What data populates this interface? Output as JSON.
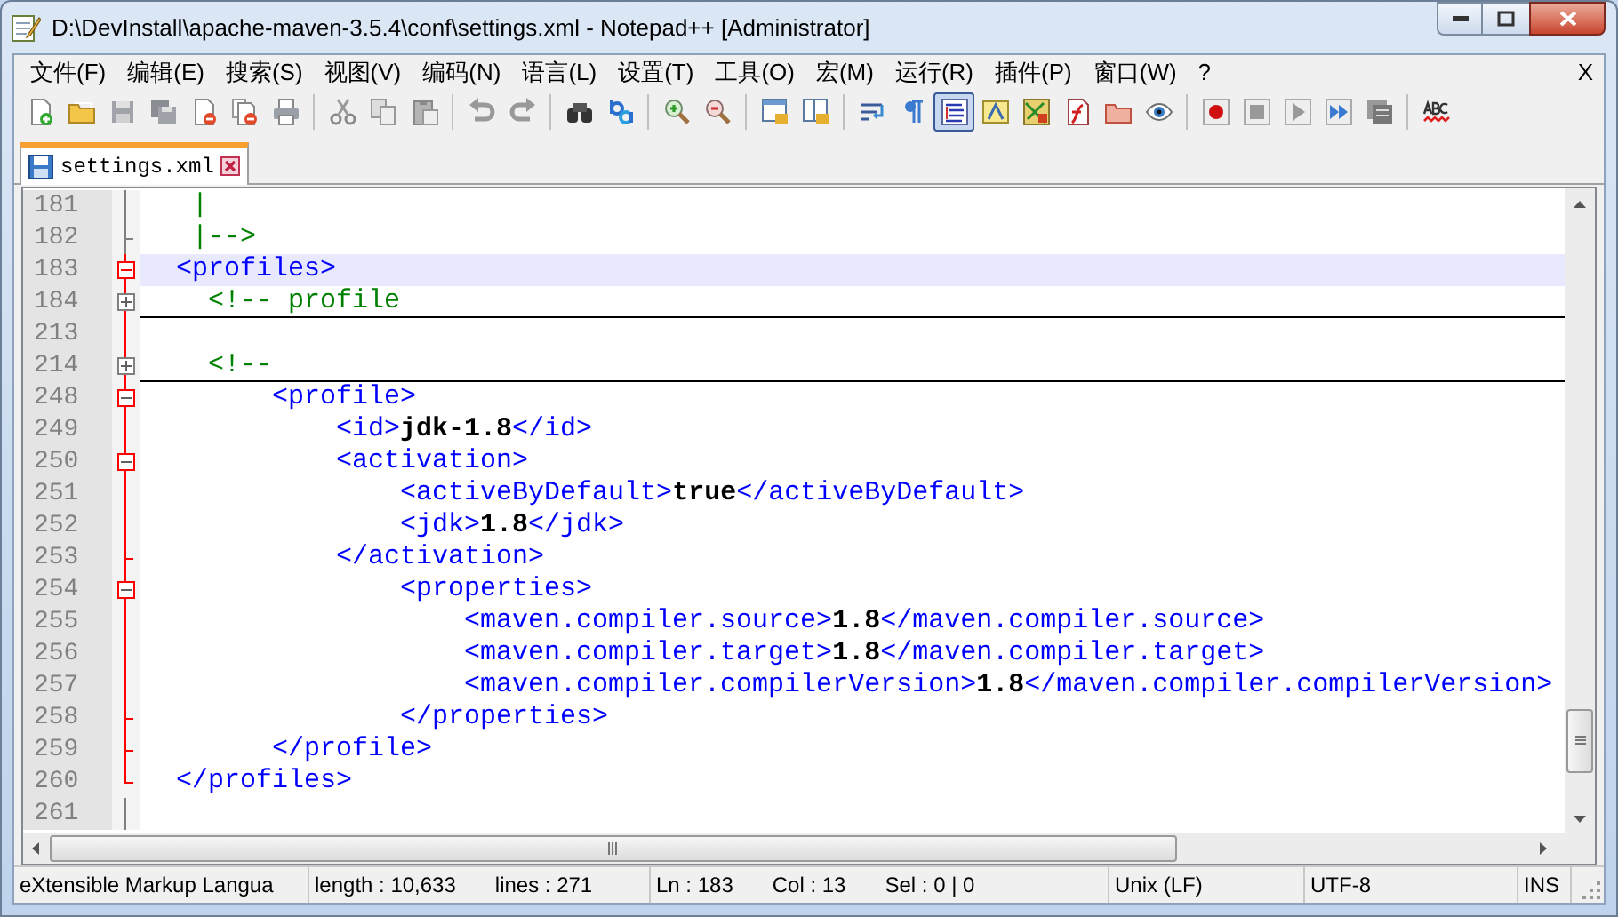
{
  "window": {
    "title": "D:\\DevInstall\\apache-maven-3.5.4\\conf\\settings.xml - Notepad++ [Administrator]"
  },
  "menu": [
    "文件(F)",
    "编辑(E)",
    "搜索(S)",
    "视图(V)",
    "编码(N)",
    "语言(L)",
    "设置(T)",
    "工具(O)",
    "宏(M)",
    "运行(R)",
    "插件(P)",
    "窗口(W)",
    "?"
  ],
  "menu_close": "X",
  "toolbar": [
    [
      {
        "pressed": false
      },
      {
        "pressed": false
      },
      {
        "pressed": false
      },
      {
        "pressed": false
      },
      {
        "pressed": false
      },
      {
        "pressed": false
      },
      {
        "pressed": false
      }
    ],
    [
      {
        "pressed": false
      },
      {
        "pressed": false
      },
      {
        "pressed": false
      }
    ],
    [
      {
        "pressed": false
      },
      {
        "pressed": false
      }
    ],
    [
      {
        "pressed": false
      },
      {
        "pressed": false
      }
    ],
    [
      {
        "pressed": false
      },
      {
        "pressed": false
      }
    ],
    [
      {
        "pressed": false
      },
      {
        "pressed": false
      }
    ],
    [
      {
        "pressed": false
      },
      {
        "pressed": false
      },
      {
        "pressed": true
      },
      {
        "pressed": false
      },
      {
        "pressed": false
      },
      {
        "pressed": false
      },
      {
        "pressed": false
      },
      {
        "pressed": false
      }
    ],
    [
      {
        "pressed": false
      },
      {
        "pressed": false
      },
      {
        "pressed": false
      },
      {
        "pressed": false
      },
      {
        "pressed": false
      }
    ],
    [
      {
        "pressed": false
      }
    ]
  ],
  "tabs": [
    {
      "label": "settings.xml",
      "selected": true
    }
  ],
  "lines": [
    {
      "number": "181",
      "fold": {
        "kind": "line",
        "highlighted": false
      },
      "current": false,
      "folded": false,
      "segments": [
        {
          "kind": "comment",
          "text": "   |"
        }
      ]
    },
    {
      "number": "182",
      "fold": {
        "kind": "tick",
        "highlighted": false
      },
      "current": false,
      "folded": false,
      "segments": [
        {
          "kind": "comment",
          "text": "   |-->"
        }
      ]
    },
    {
      "number": "183",
      "fold": {
        "kind": "open",
        "highlighted": true
      },
      "current": true,
      "folded": false,
      "segments": [
        {
          "kind": "tag",
          "text": "  <profiles>"
        }
      ]
    },
    {
      "number": "184",
      "fold": {
        "kind": "closed",
        "highlighted": true
      },
      "current": false,
      "folded": true,
      "segments": [
        {
          "kind": "comment",
          "text": "    <!-- profile"
        }
      ]
    },
    {
      "number": "213",
      "fold": {
        "kind": "line",
        "highlighted": true
      },
      "current": false,
      "folded": false
    },
    {
      "number": "214",
      "fold": {
        "kind": "closed",
        "highlighted": true
      },
      "current": false,
      "folded": true,
      "segments": [
        {
          "kind": "comment",
          "text": "    <!--"
        }
      ]
    },
    {
      "number": "248",
      "fold": {
        "kind": "open",
        "highlighted": true
      },
      "current": false,
      "folded": false,
      "segments": [
        {
          "kind": "tag",
          "text": "        <profile>"
        }
      ]
    },
    {
      "number": "249",
      "fold": {
        "kind": "line",
        "highlighted": true
      },
      "current": false,
      "folded": false,
      "segments": [
        {
          "kind": "tag",
          "text": "            <id>"
        },
        {
          "kind": "value",
          "text": "jdk-1.8"
        },
        {
          "kind": "tag",
          "text": "</id>"
        }
      ]
    },
    {
      "number": "250",
      "fold": {
        "kind": "open",
        "highlighted": true
      },
      "current": false,
      "folded": false,
      "segments": [
        {
          "kind": "tag",
          "text": "            <activation>"
        }
      ]
    },
    {
      "number": "251",
      "fold": {
        "kind": "line",
        "highlighted": true
      },
      "current": false,
      "folded": false,
      "segments": [
        {
          "kind": "tag",
          "text": "                <activeByDefault>"
        },
        {
          "kind": "value",
          "text": "true"
        },
        {
          "kind": "tag",
          "text": "</activeByDefault>"
        }
      ]
    },
    {
      "number": "252",
      "fold": {
        "kind": "line",
        "highlighted": true
      },
      "current": false,
      "folded": false,
      "segments": [
        {
          "kind": "tag",
          "text": "                <jdk>"
        },
        {
          "kind": "value",
          "text": "1.8"
        },
        {
          "kind": "tag",
          "text": "</jdk>"
        }
      ]
    },
    {
      "number": "253",
      "fold": {
        "kind": "tick",
        "highlighted": true
      },
      "current": false,
      "folded": false,
      "segments": [
        {
          "kind": "tag",
          "text": "            </activation>"
        }
      ]
    },
    {
      "number": "254",
      "fold": {
        "kind": "open",
        "highlighted": true
      },
      "current": false,
      "folded": false,
      "segments": [
        {
          "kind": "tag",
          "text": "                <properties>"
        }
      ]
    },
    {
      "number": "255",
      "fold": {
        "kind": "line",
        "highlighted": true
      },
      "current": false,
      "folded": false,
      "segments": [
        {
          "kind": "tag",
          "text": "                    <maven.compiler.source>"
        },
        {
          "kind": "value",
          "text": "1.8"
        },
        {
          "kind": "tag",
          "text": "</maven.compiler.source>"
        }
      ]
    },
    {
      "number": "256",
      "fold": {
        "kind": "line",
        "highlighted": true
      },
      "current": false,
      "folded": false,
      "segments": [
        {
          "kind": "tag",
          "text": "                    <maven.compiler.target>"
        },
        {
          "kind": "value",
          "text": "1.8"
        },
        {
          "kind": "tag",
          "text": "</maven.compiler.target>"
        }
      ]
    },
    {
      "number": "257",
      "fold": {
        "kind": "line",
        "highlighted": true
      },
      "current": false,
      "folded": false,
      "segments": [
        {
          "kind": "tag",
          "text": "                    <maven.compiler.compilerVersion>"
        },
        {
          "kind": "value",
          "text": "1.8"
        },
        {
          "kind": "tag",
          "text": "</maven.compiler.compilerVersion>"
        }
      ]
    },
    {
      "number": "258",
      "fold": {
        "kind": "tick",
        "highlighted": true
      },
      "current": false,
      "folded": false,
      "segments": [
        {
          "kind": "tag",
          "text": "                </properties>"
        }
      ]
    },
    {
      "number": "259",
      "fold": {
        "kind": "tick",
        "highlighted": true
      },
      "current": false,
      "folded": false,
      "segments": [
        {
          "kind": "tag",
          "text": "        </profile>"
        }
      ]
    },
    {
      "number": "260",
      "fold": {
        "kind": "end",
        "highlighted": true
      },
      "current": false,
      "folded": false,
      "segments": [
        {
          "kind": "tag",
          "text": "  </profiles>"
        }
      ]
    },
    {
      "number": "261",
      "fold": {
        "kind": "line",
        "highlighted": false
      },
      "current": false,
      "folded": false
    }
  ],
  "status_bar": [
    [
      "eXtensible Markup Langua"
    ],
    [
      "length : 10,633",
      "lines : 271"
    ],
    [
      "Ln : 183",
      "Col : 13",
      "Sel : 0 | 0"
    ],
    [
      "Unix (LF)"
    ],
    [
      "UTF-8"
    ],
    [
      "INS"
    ]
  ]
}
